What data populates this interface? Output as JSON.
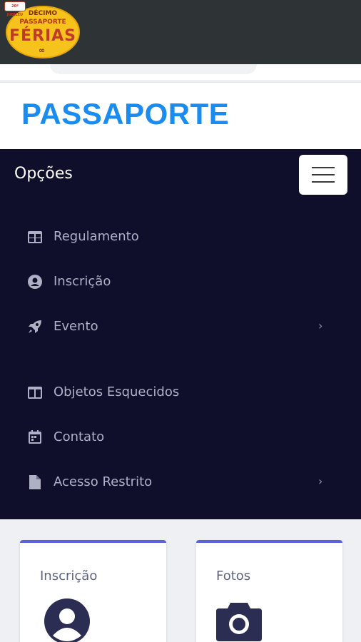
{
  "logo": {
    "badge_text": "20º JUBILEU",
    "line1": "DÉCIMO",
    "line2": "PASSAPORTE",
    "line3": "FÉRIAS",
    "glasses": "∞"
  },
  "title": "PASSAPORTE",
  "menu": {
    "heading": "Opções",
    "items": [
      {
        "label": "Regulamento",
        "icon": "table-icon",
        "has_submenu": false
      },
      {
        "label": "Inscrição",
        "icon": "user-circle-icon",
        "has_submenu": false
      },
      {
        "label": "Evento",
        "icon": "rocket-icon",
        "has_submenu": true
      },
      {
        "label": "Objetos Esquecidos",
        "icon": "columns-icon",
        "has_submenu": false
      },
      {
        "label": "Contato",
        "icon": "calendar-icon",
        "has_submenu": false
      },
      {
        "label": "Acesso Restrito",
        "icon": "file-icon",
        "has_submenu": true
      }
    ],
    "chevron": "›"
  },
  "cards": [
    {
      "title": "Inscrição",
      "icon": "user-circle-icon"
    },
    {
      "title": "Fotos",
      "icon": "camera-icon"
    }
  ],
  "colors": {
    "topbar": "#2e3436",
    "title": "#1a8cf0",
    "menu_bg": "#0f0e2b",
    "menu_text": "#aeb1c4",
    "card_accent": "#5b63d9"
  }
}
